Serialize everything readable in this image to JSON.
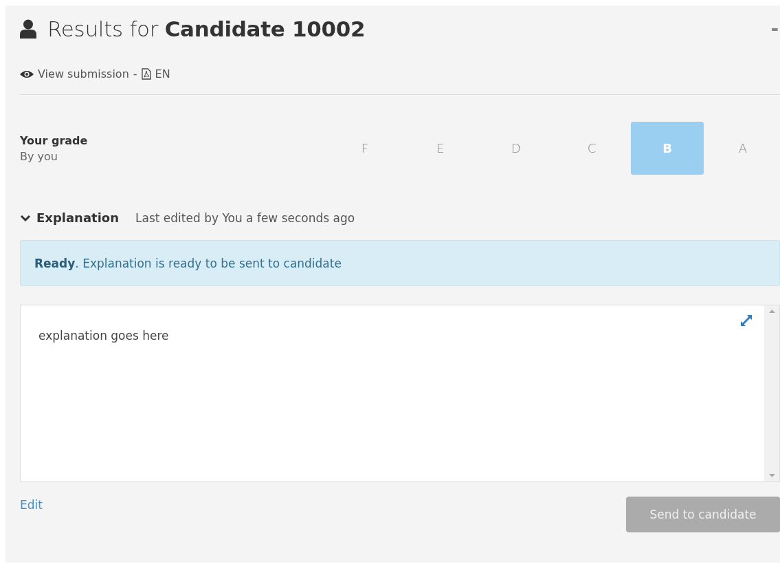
{
  "header": {
    "title": "Results for **Candidate 10002**",
    "collapse": "-"
  },
  "submission": {
    "view_link": "View submission",
    "separator": "-",
    "language_link": "EN"
  },
  "grade": {
    "label": "Your grade",
    "by": "By you",
    "options": [
      {
        "label": "F",
        "selected": false
      },
      {
        "label": "E",
        "selected": false
      },
      {
        "label": "D",
        "selected": false
      },
      {
        "label": "C",
        "selected": false
      },
      {
        "label": "B",
        "selected": true
      },
      {
        "label": "A",
        "selected": false
      }
    ]
  },
  "explanation": {
    "label": "Explanation",
    "expanded": true,
    "meta": "Last edited by You a few seconds ago",
    "alert": "**Ready**. Explanation is ready to be sent to candidate",
    "text": "explanation goes here"
  },
  "edit_link": "Edit",
  "send_button": {
    "label": "Send to candidate",
    "disabled": true
  }
}
